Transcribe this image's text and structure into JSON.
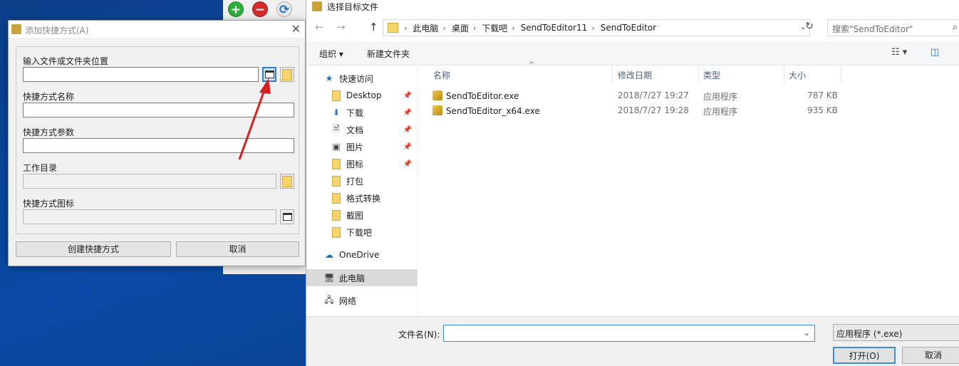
{
  "background_toolbar": {
    "icons": [
      "add-icon",
      "remove-icon",
      "refresh-icon"
    ],
    "add_glyph": "+",
    "remove_glyph": "−",
    "refresh_glyph": "⟳"
  },
  "shortcut_dialog": {
    "title": "添加快捷方式(A)",
    "close_glyph": "✕",
    "fields": {
      "location_label": "输入文件或文件夹位置",
      "location_value": "",
      "name_label": "快捷方式名称",
      "name_value": "",
      "params_label": "快捷方式参数",
      "params_value": "",
      "workdir_label": "工作目录",
      "workdir_value": "",
      "icon_label": "快捷方式图标",
      "icon_value": ""
    },
    "buttons": {
      "create": "创建快捷方式",
      "cancel": "取消"
    }
  },
  "file_dialog": {
    "title": "选择目标文件",
    "nav": {
      "back": "←",
      "forward": "→",
      "up": "↑",
      "breadcrumbs": [
        "此电脑",
        "桌面",
        "下载吧",
        "SendToEditor11",
        "SendToEditor"
      ],
      "crumb_sep": "›",
      "dropdown_glyph": "⌄",
      "refresh_glyph": "↻",
      "search_placeholder": "搜索\"SendToEditor\"",
      "search_glyph": "⌕"
    },
    "toolbar": {
      "organize": "组织 ▾",
      "new_folder": "新建文件夹",
      "view_glyph": "☷ ▾",
      "pane_glyph": "◫"
    },
    "sidebar": {
      "items": [
        {
          "label": "快速访问",
          "icon": "star-icon",
          "glyph": "★",
          "pinned": false
        },
        {
          "label": "Desktop",
          "icon": "folder-icon",
          "pinned": true
        },
        {
          "label": "下载",
          "icon": "download-icon",
          "glyph": "⬇",
          "pinned": true
        },
        {
          "label": "文档",
          "icon": "document-icon",
          "glyph": "🗎",
          "pinned": true
        },
        {
          "label": "图片",
          "icon": "picture-icon",
          "glyph": "▣",
          "pinned": true
        },
        {
          "label": "图标",
          "icon": "folder-icon",
          "pinned": true
        },
        {
          "label": "打包",
          "icon": "folder-icon",
          "pinned": false
        },
        {
          "label": "格式转换",
          "icon": "folder-icon",
          "pinned": false
        },
        {
          "label": "截图",
          "icon": "folder-icon",
          "pinned": false
        },
        {
          "label": "下载吧",
          "icon": "folder-icon",
          "pinned": false
        },
        {
          "label": "OneDrive",
          "icon": "cloud-icon",
          "glyph": "☁",
          "pinned": false
        },
        {
          "label": "此电脑",
          "icon": "computer-icon",
          "glyph": "🖥",
          "pinned": false,
          "selected": true
        },
        {
          "label": "网络",
          "icon": "network-icon",
          "glyph": "🖧",
          "pinned": false
        }
      ],
      "pin_glyph": "📌"
    },
    "columns": {
      "name": "名称",
      "modified": "修改日期",
      "type": "类型",
      "size": "大小",
      "sort_glyph": "^"
    },
    "files": [
      {
        "name": "SendToEditor.exe",
        "modified": "2018/7/27 19:27",
        "type": "应用程序",
        "size": "787 KB"
      },
      {
        "name": "SendToEditor_x64.exe",
        "modified": "2018/7/27 19:28",
        "type": "应用程序",
        "size": "935 KB"
      }
    ],
    "footer": {
      "filename_label": "文件名(N):",
      "filename_value": "",
      "filter": "应用程序 (*.exe)",
      "open": "打开(O)",
      "cancel": "取消"
    }
  },
  "annotation": {
    "arrow_color": "#d42020"
  }
}
